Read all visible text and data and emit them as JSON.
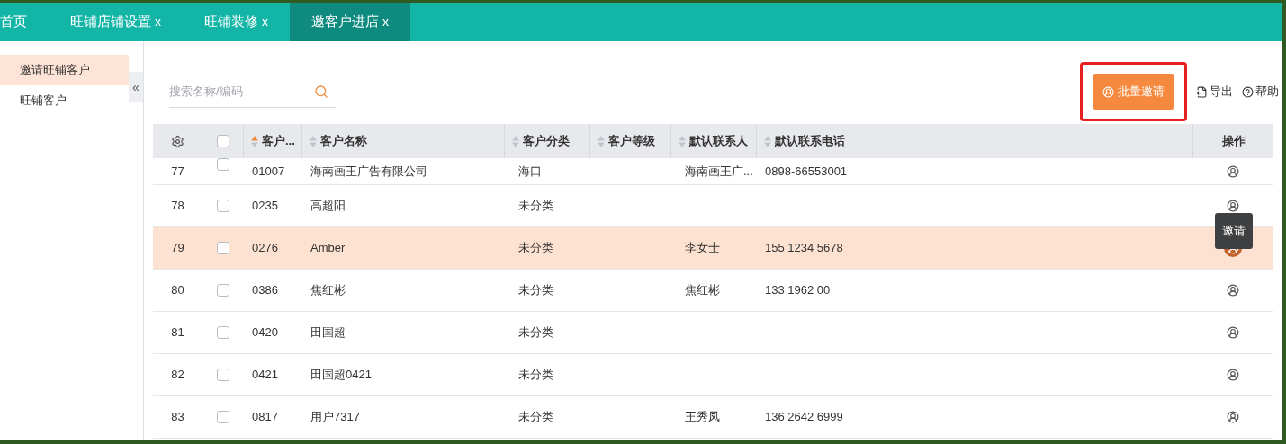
{
  "tabs": [
    {
      "label": "首页",
      "selected": false
    },
    {
      "label": "旺铺店铺设置",
      "close": "x",
      "selected": false
    },
    {
      "label": "旺铺装修",
      "close": "x",
      "selected": false
    },
    {
      "label": "邀客户进店",
      "close": "x",
      "selected": true
    }
  ],
  "sidebar": {
    "items": [
      {
        "label": "邀请旺铺客户",
        "selected": true
      },
      {
        "label": "旺铺客户",
        "selected": false
      }
    ],
    "collapse": "«"
  },
  "search": {
    "placeholder": "搜索名称/编码"
  },
  "toolbar": {
    "primary": "批量邀请",
    "export": "导出",
    "help": "帮助"
  },
  "table": {
    "header_checked": false,
    "columns": [
      {
        "label": "客户...",
        "sortable": true,
        "sorted": true
      },
      {
        "label": "客户名称",
        "sortable": true,
        "sorted": false
      },
      {
        "label": "客户分类",
        "sortable": true,
        "sorted": false
      },
      {
        "label": "客户等级",
        "sortable": true,
        "sorted": false
      },
      {
        "label": "默认联系人",
        "sortable": true,
        "sorted": false
      },
      {
        "label": "默认联系电话",
        "sortable": true,
        "sorted": false
      },
      {
        "label": "操作",
        "sortable": false
      }
    ],
    "rows": [
      {
        "index": "77",
        "checked": false,
        "selected": false,
        "cells": [
          "01007",
          "海南画王广告有限公司",
          "海口",
          "",
          "海南画王广...",
          "0898-66553001"
        ]
      },
      {
        "index": "78",
        "checked": false,
        "selected": false,
        "cells": [
          "0235",
          "高超阳",
          "未分类",
          "",
          "",
          ""
        ]
      },
      {
        "index": "79",
        "checked": false,
        "selected": true,
        "tooltip": "邀请",
        "cells": [
          "0276",
          "Amber",
          "未分类",
          "",
          "李女士",
          "155 1234 5678"
        ]
      },
      {
        "index": "80",
        "checked": false,
        "selected": false,
        "cells": [
          "0386",
          "焦红彬",
          "未分类",
          "",
          "焦红彬",
          "133 1962 00"
        ]
      },
      {
        "index": "81",
        "checked": false,
        "selected": false,
        "cells": [
          "0420",
          "田国超",
          "未分类",
          "",
          "",
          ""
        ]
      },
      {
        "index": "82",
        "checked": false,
        "selected": false,
        "cells": [
          "0421",
          "田国超0421",
          "未分类",
          "",
          "",
          ""
        ]
      },
      {
        "index": "83",
        "checked": false,
        "selected": false,
        "cells": [
          "0817",
          "用户7317",
          "未分类",
          "",
          "王秀凤",
          "136 2642 6999"
        ]
      }
    ]
  }
}
